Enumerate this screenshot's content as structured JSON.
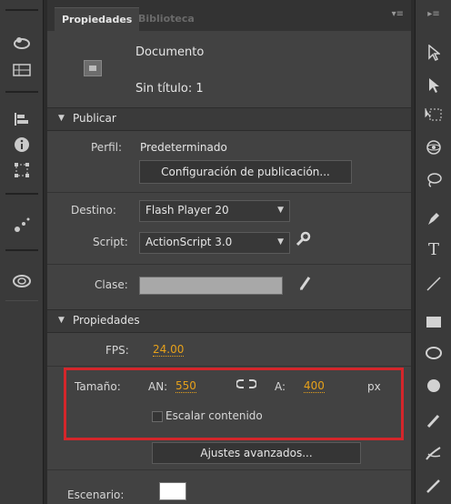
{
  "tabs": {
    "active": "Propiedades",
    "inactive": "Biblioteca"
  },
  "document": {
    "type": "Documento",
    "name": "Sin título: 1"
  },
  "publish": {
    "header": "Publicar",
    "profile_label": "Perfil:",
    "profile_value": "Predeterminado",
    "publish_settings_button": "Configuración de publicación...",
    "target_label": "Destino:",
    "target_value": "Flash Player 20",
    "script_label": "Script:",
    "script_value": "ActionScript 3.0",
    "class_label": "Clase:",
    "class_value": ""
  },
  "properties": {
    "header": "Propiedades",
    "fps_label": "FPS:",
    "fps_value": "24.00",
    "size_label": "Tamaño:",
    "width_label": "AN:",
    "width_value": "550",
    "height_label": "A:",
    "height_value": "400",
    "unit": "px",
    "scale_content_label": "Escalar contenido",
    "scale_content_checked": false,
    "advanced_button": "Ajustes avanzados...",
    "stage_label": "Escenario:",
    "stage_color": "#ffffff"
  },
  "colors": {
    "highlight_box": "#d4262b",
    "accent_number": "#e7a11a"
  }
}
